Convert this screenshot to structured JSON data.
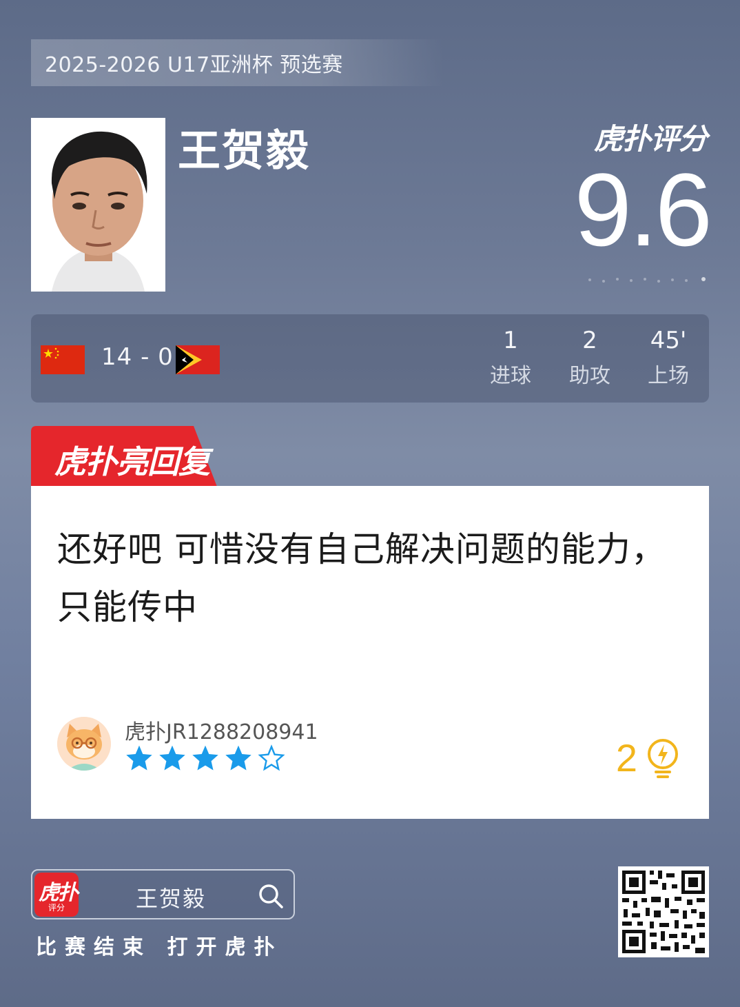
{
  "league": "2025-2026 U17亚洲杯 预选赛",
  "player": {
    "name": "王贺毅"
  },
  "rating": {
    "brand": "虎扑评分",
    "value": "9.6"
  },
  "match": {
    "score": "14 - 0",
    "home_flag": "china-flag",
    "away_flag": "timor-leste-flag",
    "stats": [
      {
        "value": "1",
        "label": "进球"
      },
      {
        "value": "2",
        "label": "助攻"
      },
      {
        "value": "45'",
        "label": "上场"
      }
    ]
  },
  "highlight_tab": {
    "label": "虎扑亮回复",
    "color": "#e5262c"
  },
  "comment": {
    "text": "还好吧 可惜没有自己解决问题的能力，只能传中",
    "user": "虎扑JR1288208941",
    "rating_stars": 4,
    "rating_max": 5,
    "likes": "2",
    "star_color": "#1a9bea",
    "like_color": "#f2b51c"
  },
  "footer": {
    "app_icon_title": "虎扑",
    "app_icon_sub": "评分",
    "search_query": "王贺毅",
    "cta": "比赛结束 打开虎扑",
    "qr_code": "qr-code"
  }
}
